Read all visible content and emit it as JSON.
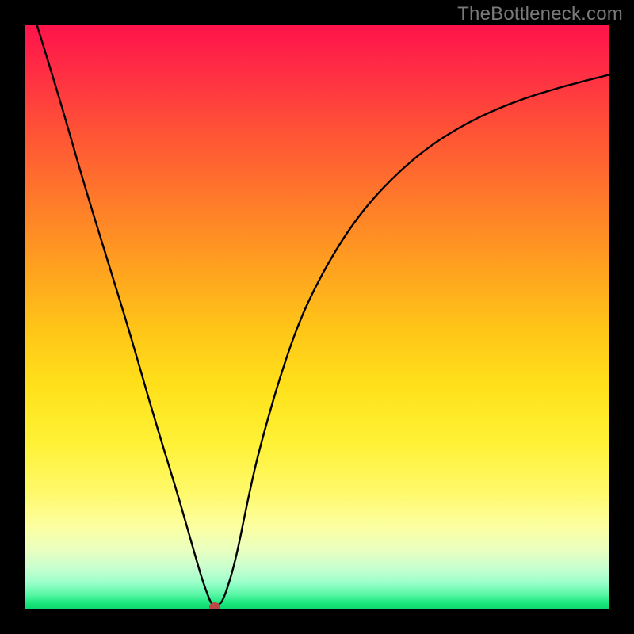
{
  "watermark": "TheBottleneck.com",
  "chart_data": {
    "type": "line",
    "title": "",
    "xlabel": "",
    "ylabel": "",
    "xlim": [
      0,
      100
    ],
    "ylim": [
      0,
      100
    ],
    "grid": false,
    "legend": false,
    "series": [
      {
        "name": "curve",
        "x": [
          2,
          6,
          10,
          14,
          18,
          22,
          26,
          28,
          30,
          31,
          32,
          33,
          34,
          36,
          38,
          40,
          44,
          48,
          54,
          60,
          68,
          76,
          84,
          92,
          100
        ],
        "y": [
          100,
          87,
          73,
          60,
          47,
          33,
          20,
          13,
          6,
          3,
          0.5,
          0.5,
          1.5,
          8,
          18,
          27,
          41,
          52,
          63,
          71,
          78.5,
          83.5,
          87,
          89.5,
          91.5
        ]
      }
    ],
    "marker": {
      "x": 32.5,
      "y": 0.3
    },
    "colors": {
      "curve": "#000000",
      "marker": "#bf4647",
      "background_top": "#ff134b",
      "background_bottom": "#0dd96c"
    }
  }
}
